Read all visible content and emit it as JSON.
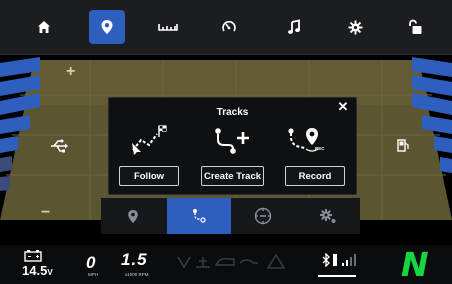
{
  "modal": {
    "title": "Tracks",
    "close_glyph": "✕",
    "options": [
      {
        "label": "Follow",
        "icon": "follow-track-icon"
      },
      {
        "label": "Create Track",
        "icon": "create-track-icon"
      },
      {
        "label": "Record",
        "icon": "record-track-icon"
      }
    ],
    "rec_badge": "REC"
  },
  "nav": {
    "items": [
      {
        "icon": "home-icon"
      },
      {
        "icon": "map-pin-icon",
        "active": true
      },
      {
        "icon": "ruler-icon"
      },
      {
        "icon": "gauge-icon"
      },
      {
        "icon": "music-note-icon"
      },
      {
        "icon": "gear-icon"
      },
      {
        "icon": "unlock-icon"
      }
    ]
  },
  "map": {
    "zoom_in_glyph": "+",
    "zoom_out_glyph": "−"
  },
  "mode_tabs": [
    {
      "icon": "waypoint-icon"
    },
    {
      "icon": "track-icon",
      "active": true
    },
    {
      "icon": "compass-icon"
    },
    {
      "icon": "settings-icon"
    }
  ],
  "status": {
    "voltage_value": "14.5",
    "voltage_unit": "V",
    "speed_value": "0",
    "speed_unit": "MPH",
    "rpm_value": "1.5",
    "rpm_unit": "x1000 RPM",
    "gear": "N"
  },
  "colors": {
    "accent_blue": "#2e5fbf",
    "map_olive": "#5b5531",
    "gear_green": "#18d642"
  }
}
